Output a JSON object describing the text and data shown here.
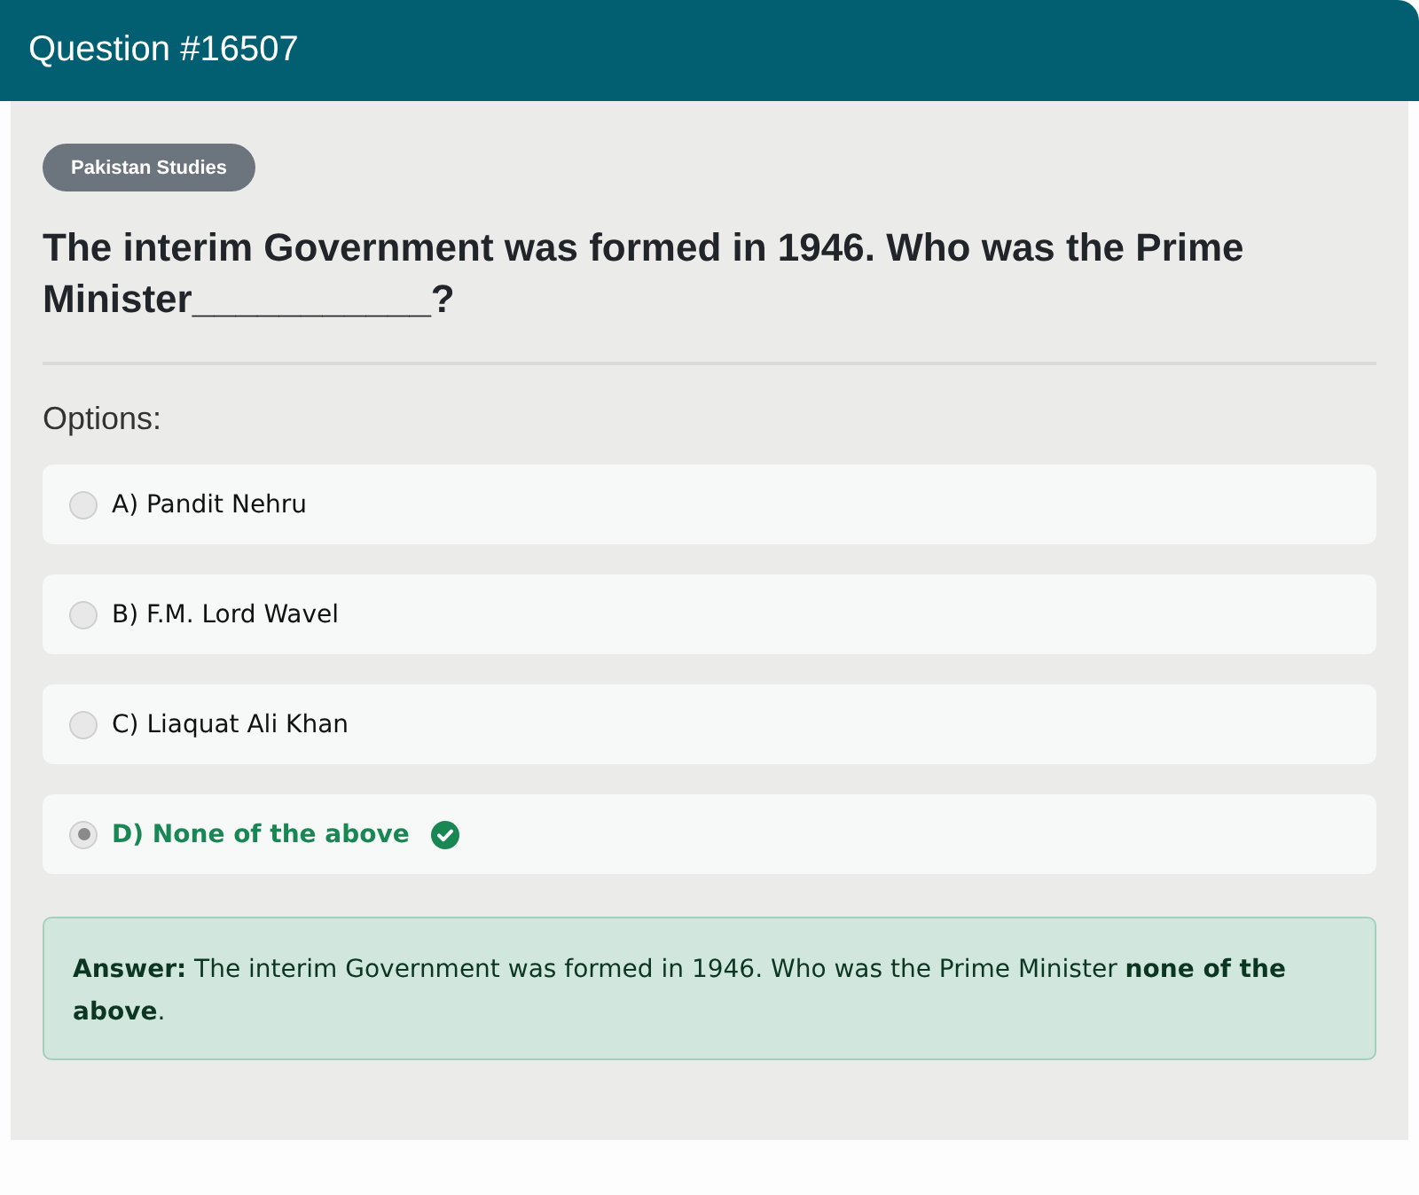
{
  "header": {
    "title": "Question #16507"
  },
  "category": "Pakistan Studies",
  "question": "The interim Government was formed in 1946. Who was the Prime Minister___________?",
  "options_label": "Options:",
  "options": [
    {
      "label": "A) Pandit Nehru",
      "selected": false,
      "correct": false
    },
    {
      "label": "B) F.M. Lord Wavel",
      "selected": false,
      "correct": false
    },
    {
      "label": "C) Liaquat Ali Khan",
      "selected": false,
      "correct": false
    },
    {
      "label": "D) None of the above",
      "selected": true,
      "correct": true
    }
  ],
  "answer": {
    "text": "**Answer:** The interim Government was formed in 1946. Who was the Prime Minister **none of the above**."
  }
}
